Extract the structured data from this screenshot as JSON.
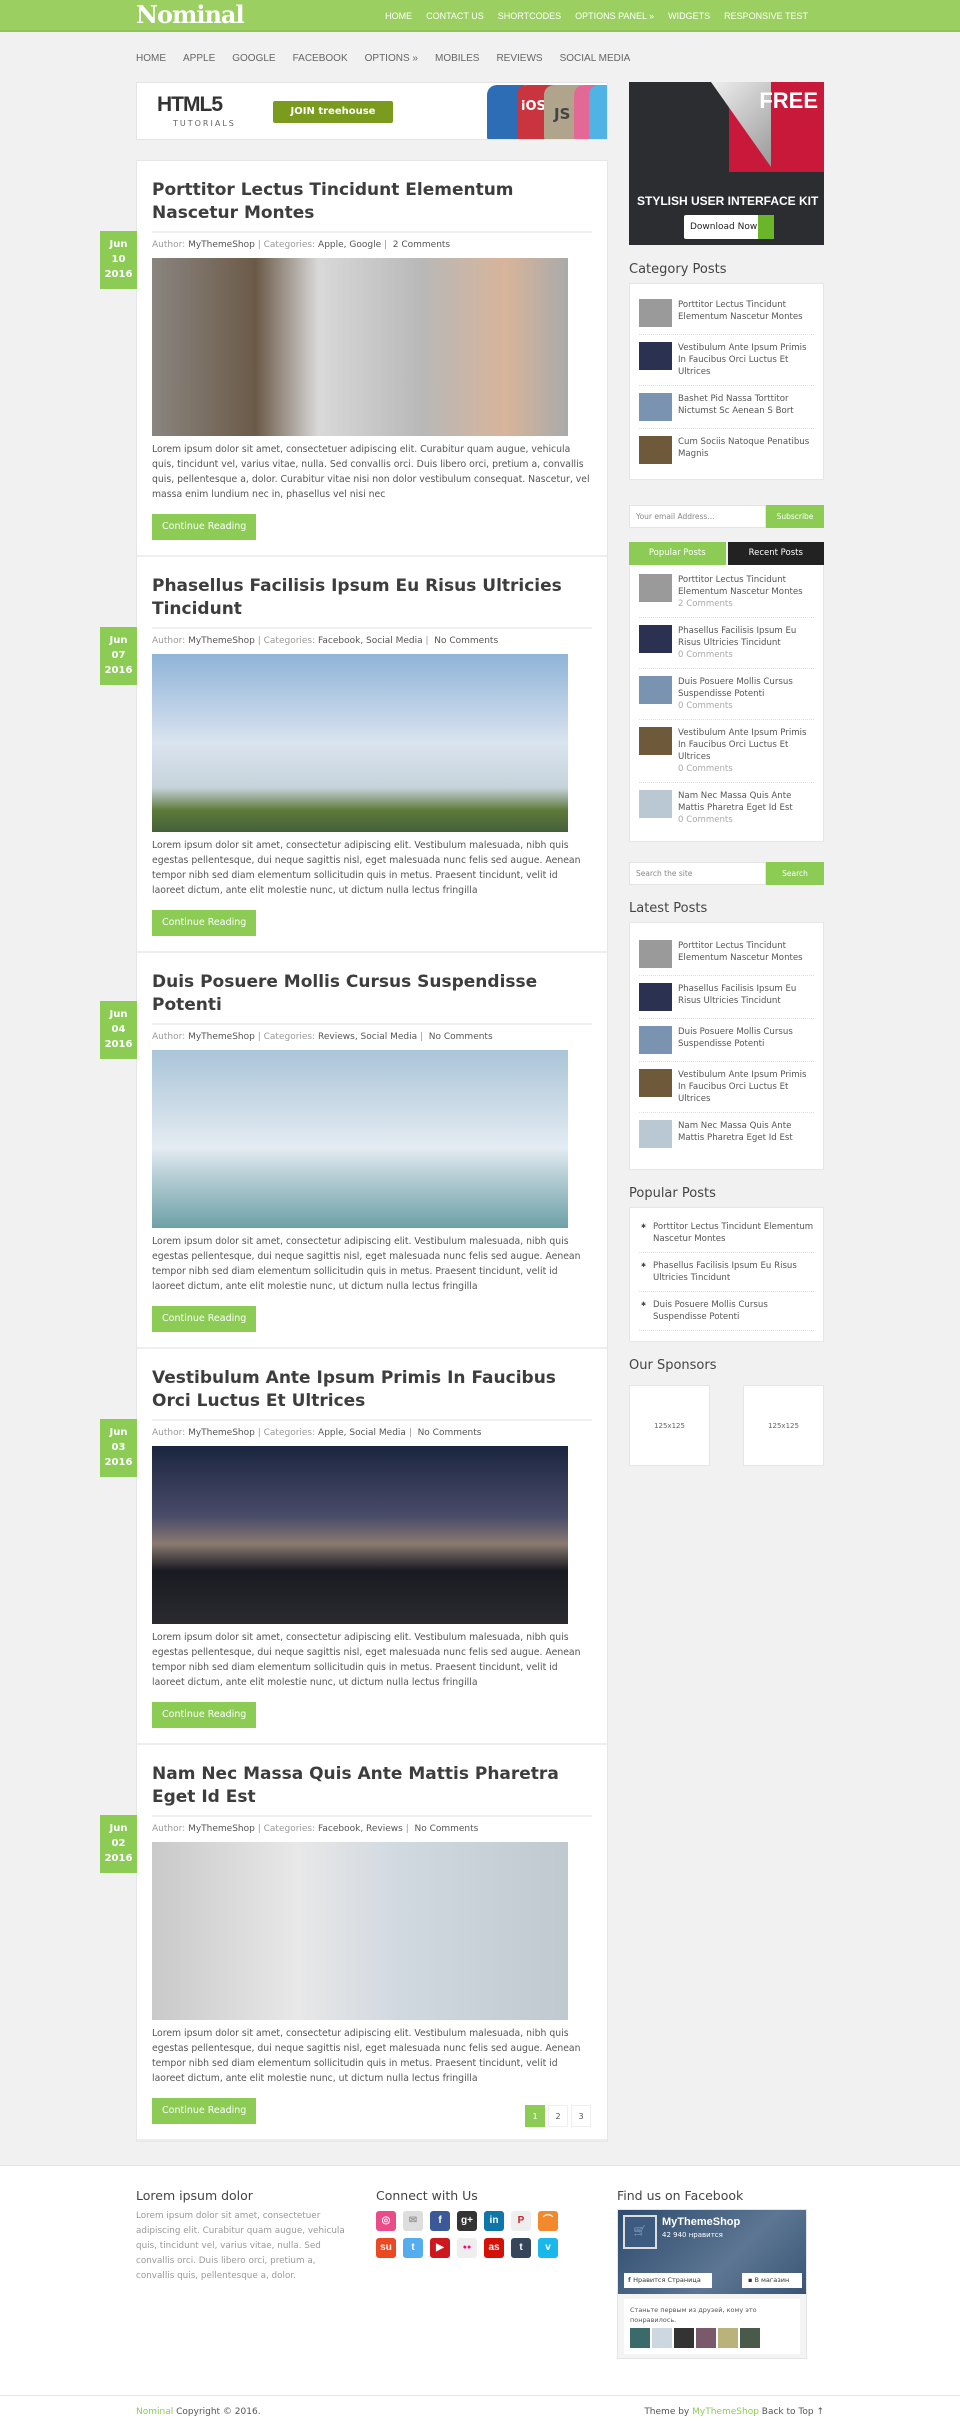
{
  "colors": {
    "accent": "#8ccc55",
    "topbar": "#9ccf62",
    "dark_tab": "#222222"
  },
  "header": {
    "logo": "Nominal",
    "nav": [
      "HOME",
      "CONTACT US",
      "SHORTCODES",
      "OPTIONS PANEL »",
      "WIDGETS",
      "RESPONSIVE TEST"
    ]
  },
  "subnav": [
    "HOME",
    "APPLE",
    "GOOGLE",
    "FACEBOOK",
    "OPTIONS »",
    "MOBILES",
    "REVIEWS",
    "SOCIAL MEDIA"
  ],
  "banner": {
    "title": "HTML5",
    "subtitle": "TUTORIALS",
    "button": "JOIN treehouse",
    "badges": [
      "iOS",
      "JS"
    ]
  },
  "side_ad": {
    "corner": "FREE",
    "title": "STYLISH USER INTERFACE KIT",
    "button": "Download Now"
  },
  "posts": [
    {
      "title": "Porttitor Lectus Tincidunt Elementum Nascetur Montes",
      "month": "Jun",
      "day": "10",
      "year": "2016",
      "author_label": "Author:",
      "author": "MyThemeShop",
      "cat_label": "Categories:",
      "categories": "Apple, Google",
      "comments": "2 Comments",
      "image": "dog-and-drawn-cat",
      "excerpt": "Lorem ipsum dolor sit amet, consectetuer adipiscing elit. Curabitur quam augue, vehicula quis, tincidunt vel, varius vitae, nulla. Sed convallis orci. Duis libero orci, pretium a, convallis quis, pellentesque a, dolor. Curabitur vitae nisi non dolor vestibulum consequat. Nascetur, vel massa enim lundium nec in, phasellus vel nisi nec",
      "button": "Continue Reading"
    },
    {
      "title": "Phasellus Facilisis Ipsum Eu Risus Ultricies Tincidunt",
      "month": "Jun",
      "day": "07",
      "year": "2016",
      "author_label": "Author:",
      "author": "MyThemeShop",
      "cat_label": "Categories:",
      "categories": "Facebook, Social Media",
      "comments": "No Comments",
      "image": "boy-on-tree",
      "excerpt": "Lorem ipsum dolor sit amet, consectetur adipiscing elit. Vestibulum malesuada, nibh quis egestas pellentesque, dui neque sagittis nisl, eget malesuada nunc felis sed augue. Aenean tempor nibh sed diam elementum sollicitudin quis in metus. Praesent tincidunt, velit id laoreet dictum, ante elit molestie nunc, ut dictum nulla lectus fringilla",
      "button": "Continue Reading"
    },
    {
      "title": "Duis Posuere Mollis Cursus Suspendisse Potenti",
      "month": "Jun",
      "day": "04",
      "year": "2016",
      "author_label": "Author:",
      "author": "MyThemeShop",
      "cat_label": "Categories:",
      "categories": "Reviews, Social Media",
      "comments": "No Comments",
      "image": "woman-in-sea",
      "excerpt": "Lorem ipsum dolor sit amet, consectetur adipiscing elit. Vestibulum malesuada, nibh quis egestas pellentesque, dui neque sagittis nisl, eget malesuada nunc felis sed augue. Aenean tempor nibh sed diam elementum sollicitudin quis in metus. Praesent tincidunt, velit id laoreet dictum, ante elit molestie nunc, ut dictum nulla lectus fringilla",
      "button": "Continue Reading"
    },
    {
      "title": "Vestibulum Ante Ipsum Primis In Faucibus Orci Luctus Et Ultrices",
      "month": "Jun",
      "day": "03",
      "year": "2016",
      "author_label": "Author:",
      "author": "MyThemeShop",
      "cat_label": "Categories:",
      "categories": "Apple, Social Media",
      "comments": "No Comments",
      "image": "night-beach",
      "excerpt": "Lorem ipsum dolor sit amet, consectetur adipiscing elit. Vestibulum malesuada, nibh quis egestas pellentesque, dui neque sagittis nisl, eget malesuada nunc felis sed augue. Aenean tempor nibh sed diam elementum sollicitudin quis in metus. Praesent tincidunt, velit id laoreet dictum, ante elit molestie nunc, ut dictum nulla lectus fringilla",
      "button": "Continue Reading"
    },
    {
      "title": "Nam Nec Massa Quis Ante Mattis Pharetra Eget Id Est",
      "month": "Jun",
      "day": "02",
      "year": "2016",
      "author_label": "Author:",
      "author": "MyThemeShop",
      "cat_label": "Categories:",
      "categories": "Facebook, Reviews",
      "comments": "No Comments",
      "image": "girl-painting-wall",
      "excerpt": "Lorem ipsum dolor sit amet, consectetur adipiscing elit. Vestibulum malesuada, nibh quis egestas pellentesque, dui neque sagittis nisl, eget malesuada nunc felis sed augue. Aenean tempor nibh sed diam elementum sollicitudin quis in metus. Praesent tincidunt, velit id laoreet dictum, ante elit molestie nunc, ut dictum nulla lectus fringilla",
      "button": "Continue Reading"
    }
  ],
  "pagination": {
    "pages": [
      "1",
      "2",
      "3"
    ],
    "current": "1"
  },
  "sidebar": {
    "category_posts": {
      "title": "Category Posts",
      "items": [
        "Porttitor Lectus Tincidunt Elementum Nascetur Montes",
        "Vestibulum Ante Ipsum Primis In Faucibus Orci Luctus Et Ultrices",
        "Bashet Pid Nassa Torttitor Nictumst Sc Aenean S Bort",
        "Cum Sociis Natoque Penatibus Magnis"
      ]
    },
    "subscribe": {
      "placeholder": "Your email Address...",
      "button": "Subscribe"
    },
    "tabs": {
      "labels": [
        "Popular Posts",
        "Recent Posts"
      ],
      "items": [
        {
          "title": "Porttitor Lectus Tincidunt Elementum Nascetur Montes",
          "comments": "2 Comments"
        },
        {
          "title": "Phasellus Facilisis Ipsum Eu Risus Ultricies Tincidunt",
          "comments": "0 Comments"
        },
        {
          "title": "Duis Posuere Mollis Cursus Suspendisse Potenti",
          "comments": "0 Comments"
        },
        {
          "title": "Vestibulum Ante Ipsum Primis In Faucibus Orci Luctus Et Ultrices",
          "comments": "0 Comments"
        },
        {
          "title": "Nam Nec Massa Quis Ante Mattis Pharetra Eget Id Est",
          "comments": "0 Comments"
        }
      ]
    },
    "search": {
      "placeholder": "Search the site",
      "button": "Search"
    },
    "latest_posts": {
      "title": "Latest Posts",
      "items": [
        "Porttitor Lectus Tincidunt Elementum Nascetur Montes",
        "Phasellus Facilisis Ipsum Eu Risus Ultricies Tincidunt",
        "Duis Posuere Mollis Cursus Suspendisse Potenti",
        "Vestibulum Ante Ipsum Primis In Faucibus Orci Luctus Et Ultrices",
        "Nam Nec Massa Quis Ante Mattis Pharetra Eget Id Est"
      ]
    },
    "popular_posts": {
      "title": "Popular Posts",
      "items": [
        "Porttitor Lectus Tincidunt Elementum Nascetur Montes",
        "Phasellus Facilisis Ipsum Eu Risus Ultricies Tincidunt",
        "Duis Posuere Mollis Cursus Suspendisse Potenti"
      ]
    },
    "sponsors": {
      "title": "Our Sponsors",
      "slots": [
        "125x125",
        "125x125"
      ]
    }
  },
  "footer": {
    "about": {
      "title": "Lorem ipsum dolor",
      "text": "Lorem ipsum dolor sit amet, consectetuer adipiscing elit. Curabitur quam augue, vehicula quis, tincidunt vel, varius vitae, nulla. Sed convallis orci. Duis libero orci, pretium a, convallis quis, pellentesque a, dolor."
    },
    "connect": {
      "title": "Connect with Us",
      "icons": [
        "dribbble-icon",
        "email-icon",
        "facebook-icon",
        "google-plus-icon",
        "linkedin-icon",
        "pinterest-icon",
        "rss-icon",
        "stumbleupon-icon",
        "twitter-icon",
        "youtube-icon",
        "flickr-icon",
        "lastfm-icon",
        "tumblr-icon",
        "vimeo-icon"
      ]
    },
    "facebook": {
      "title": "Find us on Facebook",
      "page": "MyThemeShop",
      "likes": "42 940 нравится",
      "like_button": "Нравится Страница",
      "shop_button": "В магазин",
      "friends_text": "Станьте первым из друзей, кому это понравилось."
    },
    "copyright_brand": "Nominal",
    "copyright": "Copyright © 2016.",
    "theme_by": "Theme by",
    "theme_link": "MyThemeShop",
    "back_to_top": "Back to Top ↑"
  }
}
